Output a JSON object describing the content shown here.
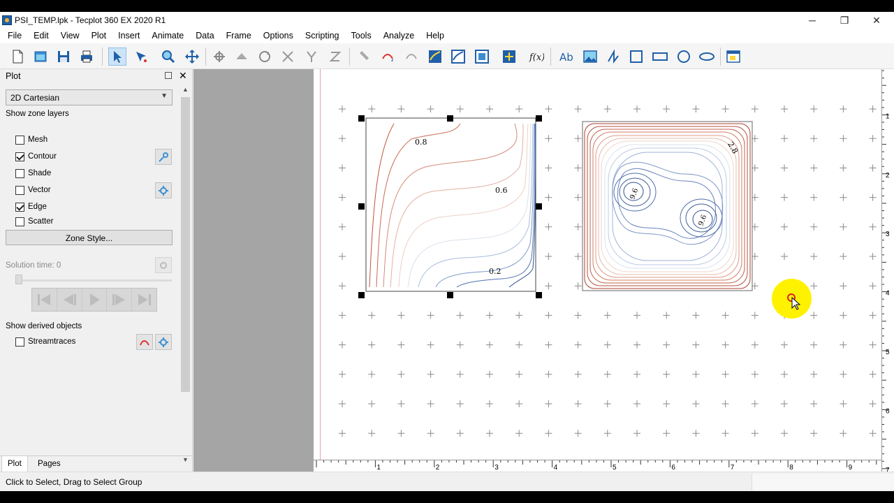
{
  "window": {
    "title": "PSI_TEMP.lpk - Tecplot 360 EX 2020 R1",
    "minimize_glyph": "─",
    "restore_glyph": "❐",
    "close_glyph": "✕"
  },
  "menu": [
    "File",
    "Edit",
    "View",
    "Plot",
    "Insert",
    "Animate",
    "Data",
    "Frame",
    "Options",
    "Scripting",
    "Tools",
    "Analyze",
    "Help"
  ],
  "toolbar_icons": [
    "new-layout-icon",
    "open-layout-icon",
    "save-icon",
    "print-icon",
    "select-icon",
    "adjust-icon",
    "zoom-icon",
    "translate-icon",
    "rotate-spherical-icon",
    "rotate-rollerball-icon",
    "rotate-twist-icon",
    "rotate-x-icon",
    "rotate-y-icon",
    "rotate-z-icon",
    "probe-icon",
    "streamtrace-icon",
    "extract-curve-icon",
    "contour-level-icon",
    "contour-add-icon",
    "iso-label-icon",
    "slice-icon",
    "equation-icon",
    "text-icon",
    "image-icon",
    "polyline-icon",
    "square-icon",
    "rectangle-icon",
    "circle-icon",
    "ellipse-icon",
    "frame-icon"
  ],
  "sidebar": {
    "title": "Plot",
    "plot_type": "2D Cartesian",
    "zone_layers_label": "Show zone layers",
    "layers": [
      {
        "label": "Mesh",
        "checked": false
      },
      {
        "label": "Contour",
        "checked": true
      },
      {
        "label": "Shade",
        "checked": false
      },
      {
        "label": "Vector",
        "checked": false
      },
      {
        "label": "Edge",
        "checked": true
      },
      {
        "label": "Scatter",
        "checked": false
      }
    ],
    "zone_style_button": "Zone Style...",
    "solution_time": "Solution time: 0",
    "derived_label": "Show derived objects",
    "streamtraces_label": "Streamtraces",
    "tabs": [
      "Plot",
      "Pages"
    ]
  },
  "status": {
    "text": "Click to Select, Drag to Select Group"
  },
  "rulers": {
    "horizontal": [
      "1",
      "2",
      "3",
      "4",
      "5",
      "6",
      "7",
      "8",
      "9"
    ],
    "vertical": [
      "1",
      "2",
      "3",
      "4",
      "5",
      "6",
      "7"
    ]
  },
  "plots": {
    "left_labels": [
      "0.8",
      "0.6",
      "0.2"
    ],
    "right_labels": [
      "2.8",
      "9.6",
      "9.6"
    ]
  },
  "colors": {
    "accent_selected": "#cde4f7",
    "cursor_highlight": "#fff200",
    "contour_warm": "#c0533f",
    "contour_cool": "#2f4f8f",
    "paper_margin": "#e6a0c8"
  }
}
